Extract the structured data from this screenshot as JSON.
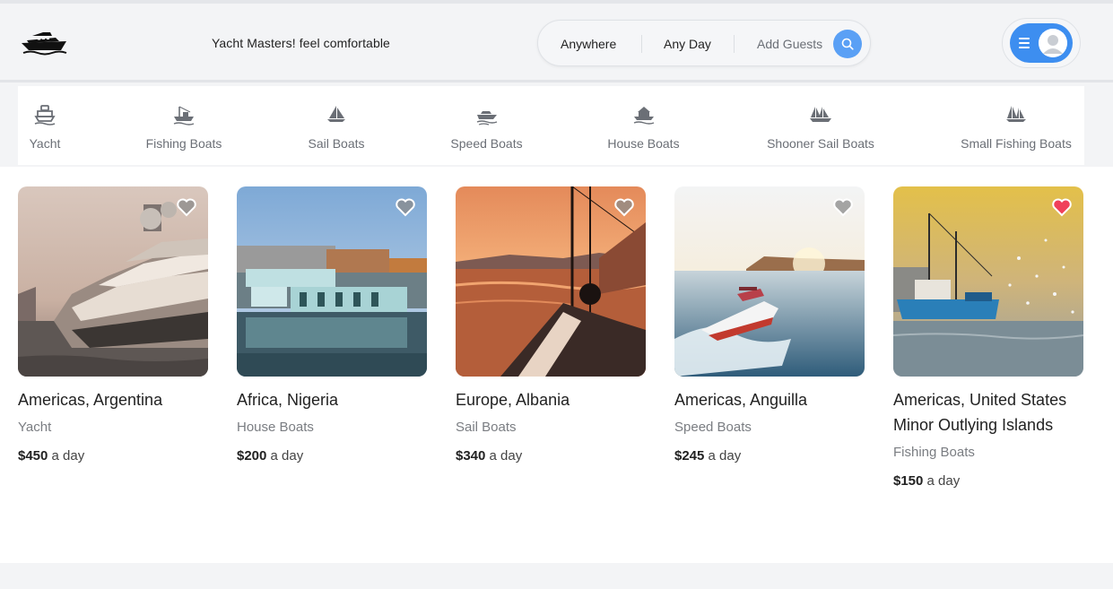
{
  "header": {
    "tagline": "Yacht Masters! feel comfortable",
    "search": {
      "location": "Anywhere",
      "date": "Any Day",
      "guests": "Add Guests"
    }
  },
  "categories": [
    {
      "label": "Yacht",
      "icon": "yacht-icon"
    },
    {
      "label": "Fishing Boats",
      "icon": "fishing-boat-icon"
    },
    {
      "label": "Sail Boats",
      "icon": "sailboat-icon"
    },
    {
      "label": "Speed Boats",
      "icon": "speedboat-icon"
    },
    {
      "label": "House Boats",
      "icon": "houseboat-icon"
    },
    {
      "label": "Shooner Sail Boats",
      "icon": "schooner-icon"
    },
    {
      "label": "Small Fishing Boats",
      "icon": "small-fishing-boat-icon"
    }
  ],
  "listings": [
    {
      "location": "Americas, Argentina",
      "type": "Yacht",
      "price": "$450",
      "unit": "a day",
      "favorited": false
    },
    {
      "location": "Africa, Nigeria",
      "type": "House Boats",
      "price": "$200",
      "unit": "a day",
      "favorited": false
    },
    {
      "location": "Europe, Albania",
      "type": "Sail Boats",
      "price": "$340",
      "unit": "a day",
      "favorited": false
    },
    {
      "location": "Americas, Anguilla",
      "type": "Speed Boats",
      "price": "$245",
      "unit": "a day",
      "favorited": false
    },
    {
      "location": "Americas, United States Minor Outlying Islands",
      "type": "Fishing Boats",
      "price": "$150",
      "unit": "a day",
      "favorited": true
    }
  ],
  "colors": {
    "accent": "#3d8ef0",
    "search_button": "#5aa0f5",
    "heart_active": "#f0405a",
    "heart_inactive": "#8a8a8a"
  }
}
